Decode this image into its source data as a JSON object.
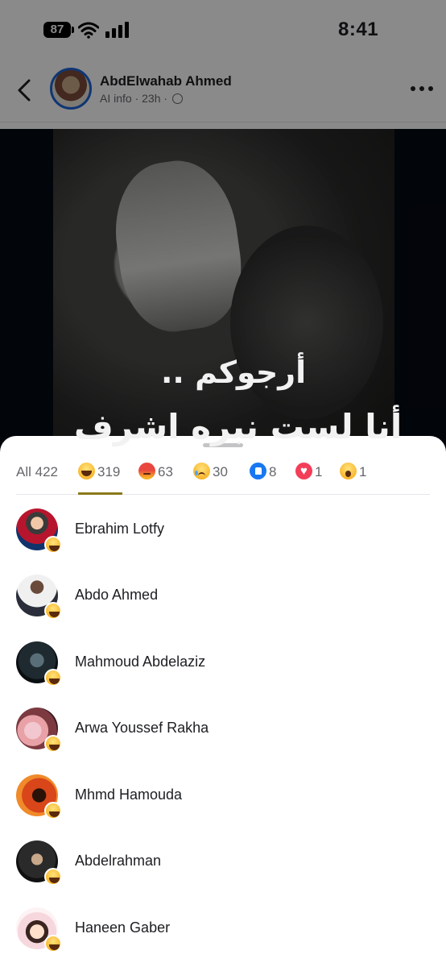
{
  "status_bar": {
    "battery": "87",
    "time": "8:41"
  },
  "post": {
    "author": "AbdElwahab Ahmed",
    "meta": "AI info · 23h ·",
    "image_text_line1": "أرجوكم ..",
    "image_text_line2": "أنا لست نبره اشرف"
  },
  "reactions_sheet": {
    "tabs": [
      {
        "label": "All 422",
        "icon": ""
      },
      {
        "label": "319",
        "icon": "haha-icon"
      },
      {
        "label": "63",
        "icon": "angry-icon"
      },
      {
        "label": "30",
        "icon": "sad-icon"
      },
      {
        "label": "8",
        "icon": "like-icon"
      },
      {
        "label": "1",
        "icon": "love-icon"
      },
      {
        "label": "1",
        "icon": "wow-icon"
      }
    ],
    "active_tab": "haha",
    "people": [
      {
        "name": "Ebrahim Lotfy",
        "reaction": "haha-icon"
      },
      {
        "name": "Abdo Ahmed",
        "reaction": "haha-icon"
      },
      {
        "name": "Mahmoud Abdelaziz",
        "reaction": "haha-icon"
      },
      {
        "name": "Arwa Youssef Rakha",
        "reaction": "haha-icon"
      },
      {
        "name": "Mhmd Hamouda",
        "reaction": "haha-icon"
      },
      {
        "name": "Abdelrahman",
        "reaction": "haha-icon"
      },
      {
        "name": "Haneen Gaber",
        "reaction": "haha-icon"
      }
    ]
  },
  "colors": {
    "accent": "#8a7a1a",
    "facebook_blue": "#1877f2",
    "overlay": "rgba(0,0,0,0.46)"
  }
}
